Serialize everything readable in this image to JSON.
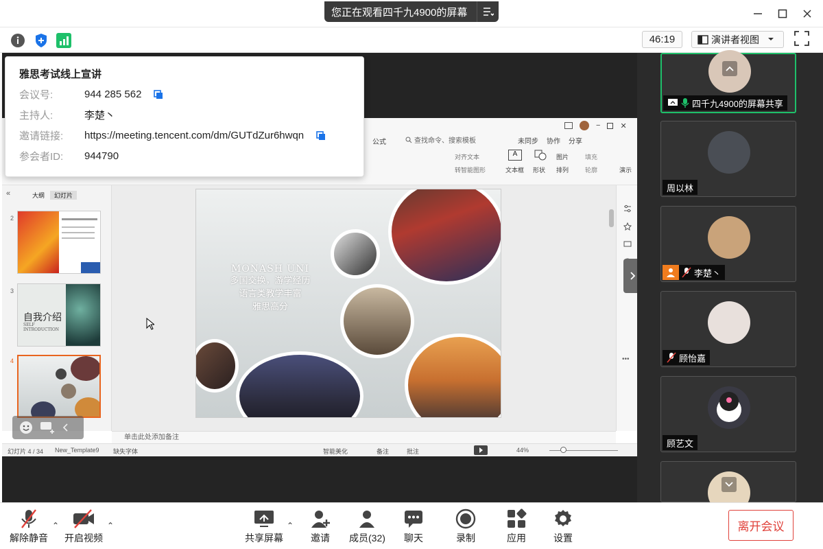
{
  "window": {
    "sharing_banner": "您正在观看四千九4900的屏幕"
  },
  "info_row": {
    "timer": "46:19",
    "view_label": "演讲者视图"
  },
  "meeting_info": {
    "title": "雅思考试线上宣讲",
    "rows": [
      {
        "key": "会议号:",
        "value": "944 285 562"
      },
      {
        "key": "主持人:",
        "value": "李楚丶"
      },
      {
        "key": "邀请链接:",
        "value": "https://meeting.tencent.com/dm/GUTdZur6hwqn"
      },
      {
        "key": "参会者ID:",
        "value": "944790"
      }
    ]
  },
  "ppt": {
    "tabs": [
      "大纲",
      "幻灯片"
    ],
    "slide_text": {
      "heading": "MONASH UNI",
      "lines": [
        "多国交换，游学经历",
        "语言类教学丰富",
        "雅思高分"
      ]
    },
    "thumbs": [
      {
        "num": "2"
      },
      {
        "num": "3",
        "title": "自我介绍",
        "sub": "SELF INTRODUCTION"
      },
      {
        "num": "4"
      }
    ],
    "notes": "单击此处添加备注",
    "status": {
      "slide_counter": "幻灯片 4 / 34",
      "template": "New_Template9",
      "missing_font": "缺失字体",
      "beautify": "智能美化",
      "remark": "备注",
      "comment": "批注",
      "zoom": "44%"
    },
    "toolbar_labels": {
      "sync": "未同步",
      "collab": "协作",
      "share": "分享",
      "search": "查找命令、搜索模板",
      "textbox": "文本框",
      "shape": "形状",
      "picture": "图片",
      "fill": "填充",
      "arrange": "排列",
      "outline": "轮廓",
      "align_text": "对齐文本",
      "smart_convert": "转智能图形",
      "formula": "公式",
      "present": "演示"
    }
  },
  "participants": [
    {
      "name": "四千九4900的屏幕共享",
      "active": true,
      "avatar_color": "#d9c7b8"
    },
    {
      "name": "周以林",
      "active": false,
      "avatar_color": "#4a4e55"
    },
    {
      "name": "李楚丶",
      "active": false,
      "avatar_color": "#c9a37a"
    },
    {
      "name": "顾怡嘉",
      "active": false,
      "avatar_color": "#e8e0dc"
    },
    {
      "name": "顾艺文",
      "active": false,
      "avatar_color": "#3a3a44"
    },
    {
      "name": "",
      "active": false,
      "avatar_color": "#e6d6bd"
    }
  ],
  "toolbar": {
    "unmute": "解除静音",
    "video": "开启视频",
    "share": "共享屏幕",
    "invite": "邀请",
    "members": "成员(32)",
    "chat": "聊天",
    "record": "录制",
    "apps": "应用",
    "settings": "设置",
    "leave": "离开会议"
  },
  "colors": {
    "accent_blue": "#1a73e8",
    "active_green": "#1ec06a",
    "leave_red": "#e0413a"
  }
}
